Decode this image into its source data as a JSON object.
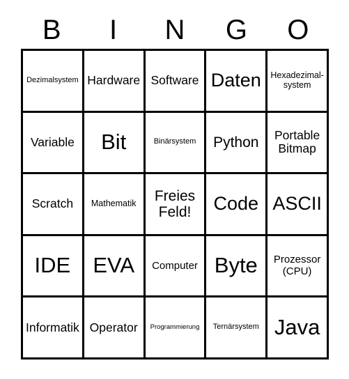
{
  "card": {
    "type": "bingo-card",
    "columns": 5,
    "rows": 5,
    "colors": {
      "background": "#ffffff",
      "text": "#000000",
      "border": "#000000"
    },
    "header": {
      "letters": [
        "B",
        "I",
        "N",
        "G",
        "O"
      ]
    },
    "free_space": {
      "row": 3,
      "column": 3,
      "label": "Freies\nFeld!"
    },
    "cells": [
      [
        {
          "text": "Dezimalsystem",
          "size": "s-xs"
        },
        {
          "text": "Hardware",
          "size": "s-lg"
        },
        {
          "text": "Software",
          "size": "s-lg"
        },
        {
          "text": "Daten",
          "size": "s-xxl"
        },
        {
          "text": "Hexadezimal-\nsystem",
          "size": "s-sm"
        }
      ],
      [
        {
          "text": "Variable",
          "size": "s-lg"
        },
        {
          "text": "Bit",
          "size": "s-huge"
        },
        {
          "text": "Binärsystem",
          "size": "s-xs"
        },
        {
          "text": "Python",
          "size": "s-xl"
        },
        {
          "text": "Portable\nBitmap",
          "size": "s-lg"
        }
      ],
      [
        {
          "text": "Scratch",
          "size": "s-lg"
        },
        {
          "text": "Mathematik",
          "size": "s-sm"
        },
        {
          "text": "Freies\nFeld!",
          "size": "s-xl"
        },
        {
          "text": "Code",
          "size": "s-xxl"
        },
        {
          "text": "ASCII",
          "size": "s-xxl"
        }
      ],
      [
        {
          "text": "IDE",
          "size": "s-huge"
        },
        {
          "text": "EVA",
          "size": "s-huge"
        },
        {
          "text": "Computer",
          "size": "s-md"
        },
        {
          "text": "Byte",
          "size": "s-huge"
        },
        {
          "text": "Prozessor\n(CPU)",
          "size": "s-md"
        }
      ],
      [
        {
          "text": "Informatik",
          "size": "s-lg"
        },
        {
          "text": "Operator",
          "size": "s-lg"
        },
        {
          "text": "Programmierung",
          "size": "s-xxs"
        },
        {
          "text": "Ternärsystem",
          "size": "s-xs"
        },
        {
          "text": "Java",
          "size": "s-huge"
        }
      ]
    ]
  }
}
